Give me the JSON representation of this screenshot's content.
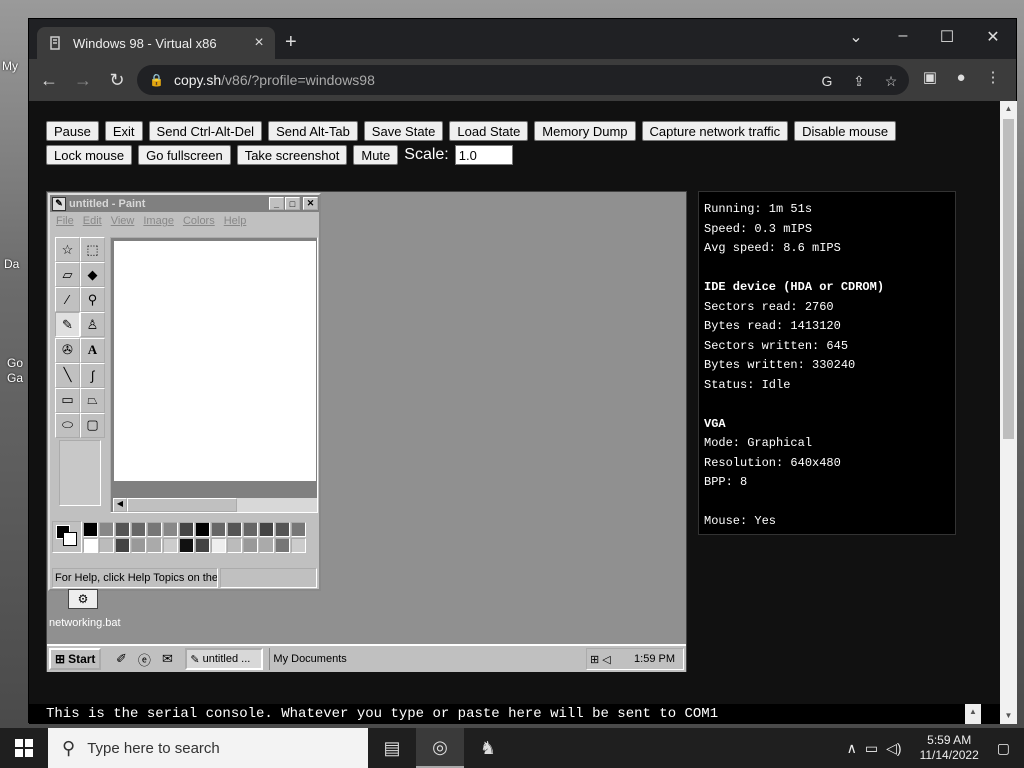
{
  "desktop": {
    "labels": [
      "My",
      "Da",
      "Go",
      "Ga"
    ]
  },
  "browser": {
    "tab_title": "Windows 98 - Virtual x86",
    "tab_close": "×",
    "new_tab": "+",
    "url_host": "copy.sh",
    "url_path": "/v86/?profile=windows98"
  },
  "controls": {
    "row1": [
      "Pause",
      "Exit",
      "Send Ctrl-Alt-Del",
      "Send Alt-Tab",
      "Save State",
      "Load State",
      "Memory Dump",
      "Capture network traffic",
      "Disable mouse"
    ],
    "row2": [
      "Lock mouse",
      "Go fullscreen",
      "Take screenshot",
      "Mute"
    ],
    "scale_label": "Scale:",
    "scale_value": "1.0"
  },
  "paint": {
    "title": "untitled - Paint",
    "menu": [
      "File",
      "Edit",
      "View",
      "Image",
      "Colors",
      "Help"
    ],
    "status": "For Help, click Help Topics on the"
  },
  "win98": {
    "desktop_icon_label": "networking.bat",
    "start": "Start",
    "task1": "untitled ...",
    "task2": "My Documents",
    "clock": "1:59 PM"
  },
  "stats": {
    "running": "Running: 1m 51s",
    "speed": "Speed: 0.3 mIPS",
    "avg_speed": "Avg speed: 8.6 mIPS",
    "ide_header": "IDE device (HDA or CDROM)",
    "sectors_read": "Sectors read: 2760",
    "bytes_read": "Bytes read: 1413120",
    "sectors_written": "Sectors written: 645",
    "bytes_written": "Bytes written: 330240",
    "status": "Status: Idle",
    "vga_header": "VGA",
    "mode": "Mode: Graphical",
    "resolution": "Resolution: 640x480",
    "bpp": "BPP: 8",
    "mouse": "Mouse: Yes"
  },
  "serial_text": "This is the serial console. Whatever you type or paste here will be sent to COM1",
  "taskbar": {
    "search_placeholder": "Type here to search",
    "time": "5:59 AM",
    "date": "11/14/2022"
  }
}
